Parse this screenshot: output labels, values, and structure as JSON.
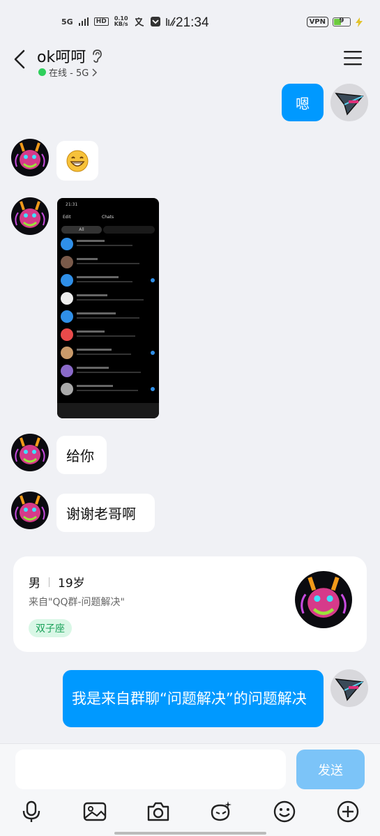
{
  "status_bar": {
    "network": "5G",
    "hd": "HD",
    "speed_value": "0.10",
    "speed_unit": "KB/s",
    "time": "21:34",
    "vpn": "VPN",
    "battery": "9"
  },
  "header": {
    "title": "ok呵呵",
    "status": "在线 - 5G",
    "status_color": "#2fcf5c"
  },
  "messages": [
    {
      "side": "out",
      "text": "嗯"
    },
    {
      "side": "in",
      "type": "emoji",
      "text": "😁"
    },
    {
      "side": "in",
      "type": "image",
      "alt": "chat-list-screenshot"
    },
    {
      "side": "in",
      "text": "给你"
    },
    {
      "side": "in",
      "text": "谢谢老哥啊"
    },
    {
      "side": "out",
      "text": "我是来自群聊“问题解决”的问题解决"
    }
  ],
  "screenshot": {
    "time": "21:31",
    "edit": "Edit",
    "title": "Chats",
    "tab_all": "All"
  },
  "profile_card": {
    "gender": "男",
    "age": "19岁",
    "source": "来自\"QQ群-问题解决\"",
    "tag": "双子座"
  },
  "input": {
    "placeholder": "",
    "send_label": "发送"
  },
  "toolbar_icons": [
    "microphone-icon",
    "image-icon",
    "camera-icon",
    "sticker-icon",
    "emoji-icon",
    "plus-icon"
  ],
  "colors": {
    "accent": "#0099ff",
    "background": "#f0f1f5",
    "send_disabled": "#7cc4f8"
  }
}
